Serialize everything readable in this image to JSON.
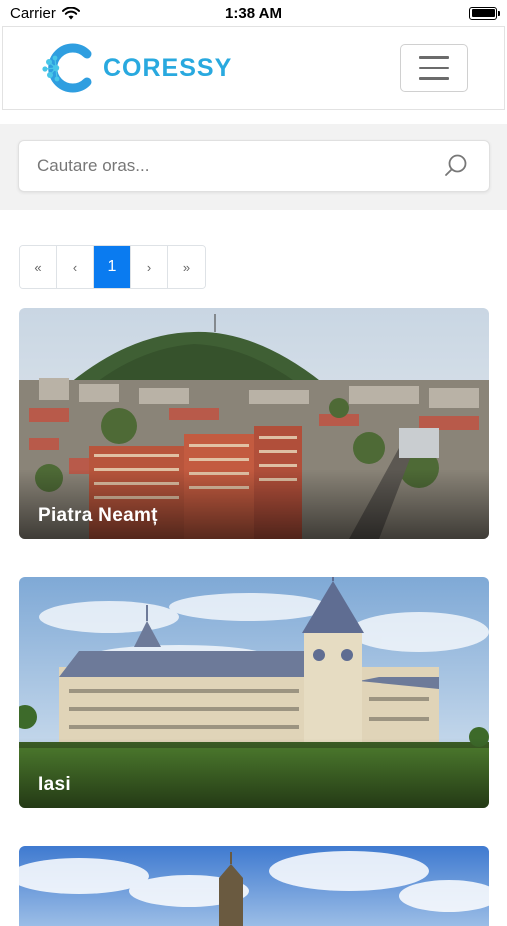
{
  "status_bar": {
    "carrier": "Carrier",
    "time": "1:38 AM"
  },
  "header": {
    "logo_text": "CORESSY",
    "brand_color": "#29a9df"
  },
  "search": {
    "placeholder": "Cautare oras..."
  },
  "pagination": {
    "first": "«",
    "prev": "‹",
    "current": "1",
    "next": "›",
    "last": "»",
    "active_color": "#0a7bf0"
  },
  "cities": [
    {
      "name": "Piatra Neamț"
    },
    {
      "name": "Iasi"
    },
    {
      "name": ""
    }
  ],
  "icons": {
    "wifi": "wifi-icon",
    "battery": "battery-icon",
    "menu": "hamburger-menu-icon",
    "search": "search-icon",
    "logo": "coressy-logo-icon"
  }
}
